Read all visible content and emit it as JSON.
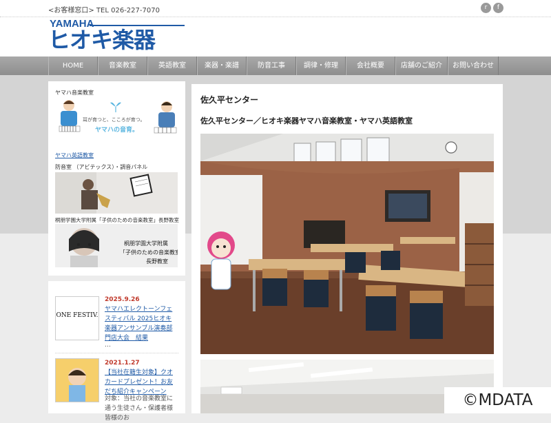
{
  "header": {
    "contact": "<お客様窓口> TEL 026-227-7070",
    "logo_top": "YAMAHA",
    "logo_main": "ヒオキ楽器",
    "social": [
      {
        "icon": "rss-icon",
        "glyph": "r"
      },
      {
        "icon": "facebook-icon",
        "glyph": "f"
      }
    ]
  },
  "nav": {
    "items": [
      "HOME",
      "音楽教室",
      "英語教室",
      "楽器・楽譜",
      "防音工事",
      "調律・修理",
      "会社概要",
      "店舗のご紹介",
      "お問い合わせ"
    ]
  },
  "sidebar": {
    "music_school_label": "ヤマハ音楽教室",
    "music_banner_text1": "耳が育つと、こころが育つ。",
    "music_banner_text2": "ヤマハの音育。",
    "english_link": "ヤマハ英語教室",
    "soundproof_label": "防音室 （アビテックス）・調音パネル",
    "toho_label": "桐朋学園大学附属「子供のための音楽教室」長野教室",
    "toho_banner_line1": "桐朋学園大学附属",
    "toho_banner_line2": "「子供のための音楽教室」",
    "toho_banner_line3": "長野教室"
  },
  "news": [
    {
      "thumb_text": "ONE FESTIV.",
      "date": "2025.9.26",
      "title": "ヤマハエレクトーンフェスティバル 2025ヒオキ楽器アンサンブル演奏部門店大会　結果",
      "desc": "…"
    },
    {
      "thumb_text": "",
      "date": "2021.1.27",
      "title": "【当社在籍生対象】クオカードプレゼント！お友だち紹介キャンペーン",
      "desc": "対象：当社の音楽教室に通う生徒さん・保護者様皆様のお"
    }
  ],
  "main": {
    "title": "佐久平センター",
    "subtitle": "佐久平センター／ヒオキ楽器ヤマハ音楽教室・ヤマハ英語教室"
  },
  "watermark": "©MDATA",
  "colors": {
    "brand": "#1f5aa6",
    "nav": "#9a9a9a",
    "date": "#c0392b"
  }
}
